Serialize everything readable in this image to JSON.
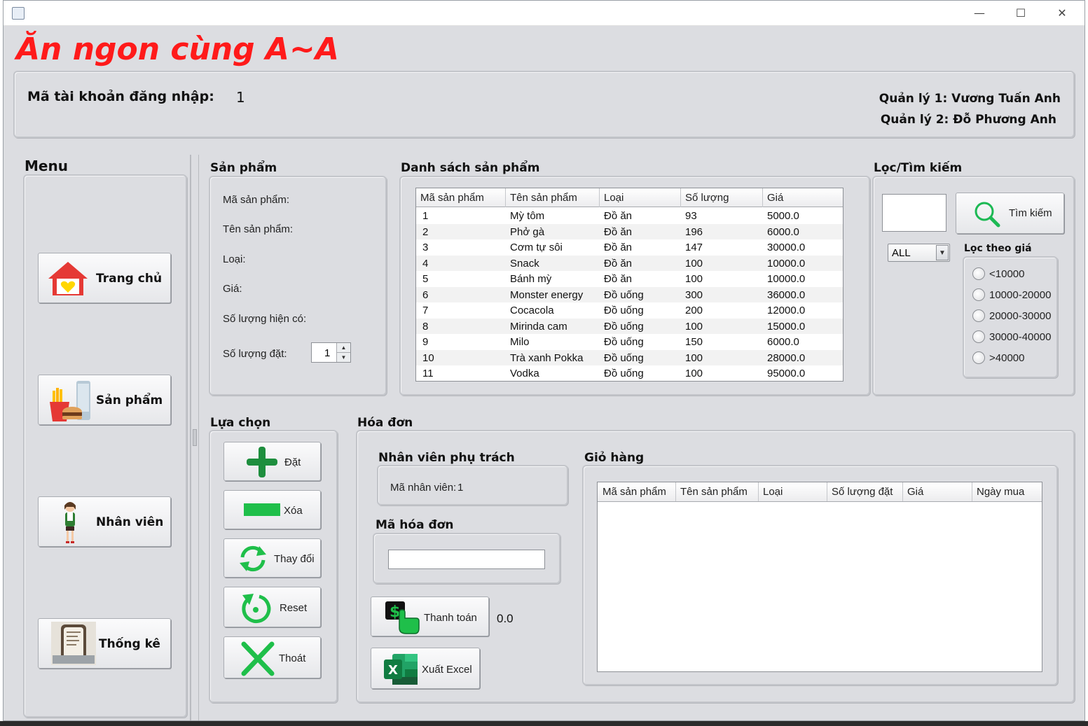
{
  "window": {
    "controls": {
      "minimize": "—",
      "maximize": "☐",
      "close": "✕"
    }
  },
  "brand": "Ăn ngon cùng A~A",
  "header": {
    "account_label": "Mã tài khoản đăng nhập:",
    "account_id": "1",
    "manager1": "Quản lý 1: Vương Tuấn Anh",
    "manager2": "Quản lý 2: Đỗ Phương Anh"
  },
  "menu": {
    "title": "Menu",
    "items": [
      {
        "label": "Trang chủ",
        "icon": "home-icon"
      },
      {
        "label": "Sản phẩm",
        "icon": "food-icon"
      },
      {
        "label": "Nhân viên",
        "icon": "employee-icon"
      },
      {
        "label": "Thống kê",
        "icon": "statistics-icon"
      }
    ]
  },
  "product": {
    "title": "Sản phẩm",
    "fields": {
      "id": "Mã sản phẩm:",
      "name": "Tên sản phẩm:",
      "type": "Loại:",
      "price": "Giá:",
      "stock": "Số lượng hiện có:",
      "order_qty": "Số lượng đặt:"
    },
    "order_qty_value": "1"
  },
  "product_list": {
    "title": "Danh sách sản phẩm",
    "columns": [
      "Mã sản phẩm",
      "Tên sản phẩm",
      "Loại",
      "Số lượng",
      "Giá"
    ],
    "rows": [
      [
        "1",
        "Mỳ tôm",
        "Đồ ăn",
        "93",
        "5000.0"
      ],
      [
        "2",
        "Phở gà",
        "Đồ ăn",
        "196",
        "6000.0"
      ],
      [
        "3",
        "Cơm tự sôi",
        "Đồ ăn",
        "147",
        "30000.0"
      ],
      [
        "4",
        "Snack",
        "Đồ ăn",
        "100",
        "10000.0"
      ],
      [
        "5",
        "Bánh mỳ",
        "Đồ ăn",
        "100",
        "10000.0"
      ],
      [
        "6",
        "Monster energy",
        "Đồ uống",
        "300",
        "36000.0"
      ],
      [
        "7",
        "Cocacola",
        "Đồ uống",
        "200",
        "12000.0"
      ],
      [
        "8",
        "Mirinda cam",
        "Đồ uống",
        "100",
        "15000.0"
      ],
      [
        "9",
        "Milo",
        "Đồ uống",
        "150",
        "6000.0"
      ],
      [
        "10",
        "Trà xanh Pokka",
        "Đồ uống",
        "100",
        "28000.0"
      ],
      [
        "11",
        "Vodka",
        "Đồ uống",
        "100",
        "95000.0"
      ]
    ]
  },
  "filter": {
    "title": "Lọc/Tìm kiếm",
    "search_value": "",
    "search_button": "Tìm kiếm",
    "category_selected": "ALL",
    "price_title": "Lọc theo giá",
    "price_options": [
      "<10000",
      "10000-20000",
      "20000-30000",
      "30000-40000",
      ">40000"
    ]
  },
  "actions": {
    "title": "Lựa chọn",
    "buttons": [
      {
        "label": "Đặt",
        "icon": "plus-icon"
      },
      {
        "label": "Xóa",
        "icon": "minus-icon"
      },
      {
        "label": "Thay đổi",
        "icon": "refresh-icon"
      },
      {
        "label": "Reset",
        "icon": "reset-icon"
      },
      {
        "label": "Thoát",
        "icon": "exit-icon"
      }
    ]
  },
  "invoice": {
    "title": "Hóa đơn",
    "staff_title": "Nhân viên phụ trách",
    "staff_label": "Mã nhân viên:",
    "staff_id": "1",
    "invoice_id_title": "Mã hóa đơn",
    "invoice_id_value": "",
    "pay_button": "Thanh toán",
    "total": "0.0",
    "excel_button": "Xuất Excel"
  },
  "cart": {
    "title": "Giỏ hàng",
    "columns": [
      "Mã sản phẩm",
      "Tên sản phẩm",
      "Loại",
      "Số lượng đặt",
      "Giá",
      "Ngày mua"
    ],
    "rows": []
  },
  "colors": {
    "brand": "#ff1a1a",
    "accent_green": "#1db954",
    "window_bg": "#dcdde1"
  }
}
